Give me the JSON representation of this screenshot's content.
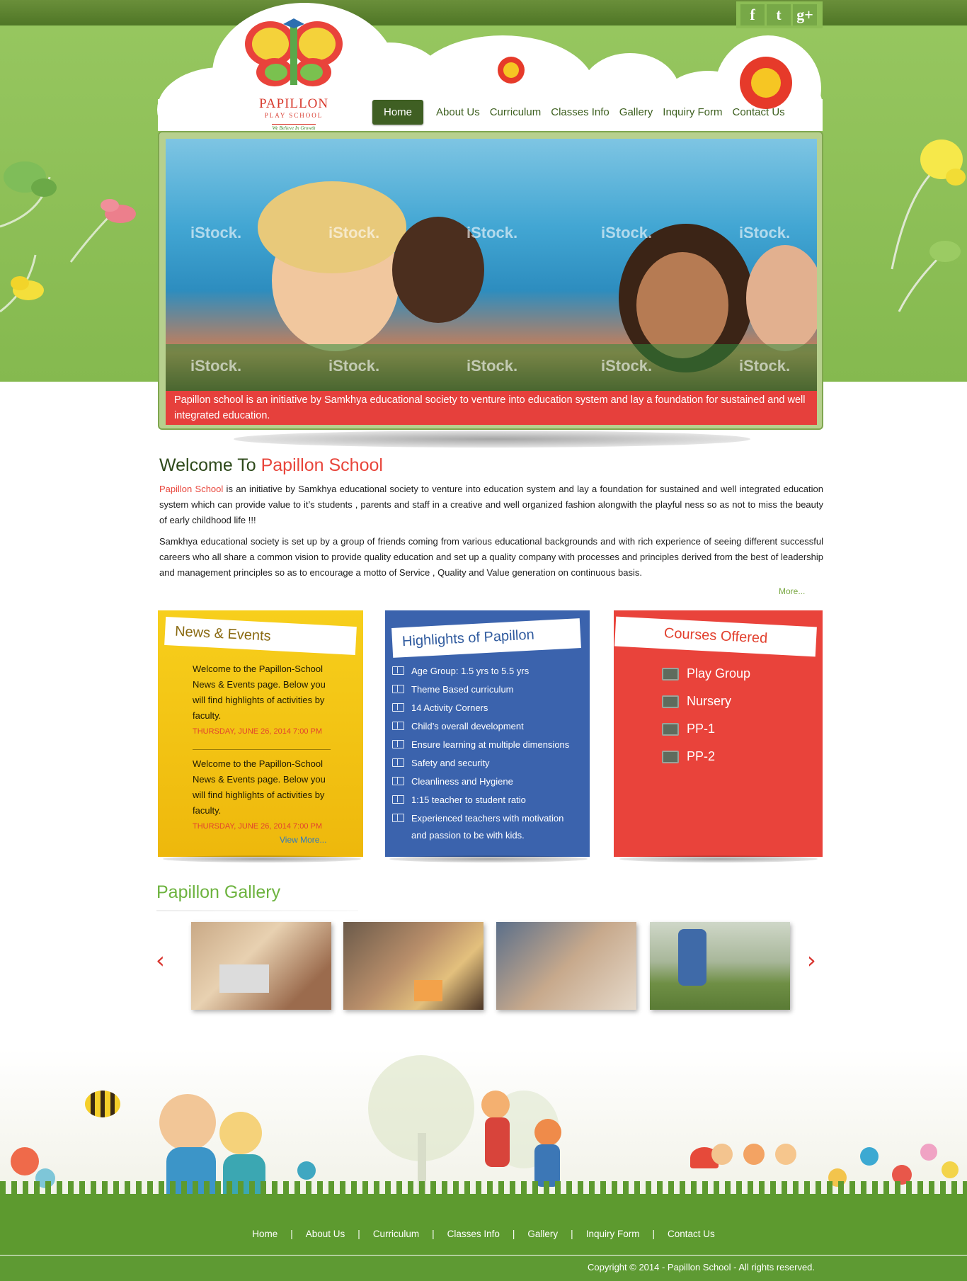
{
  "social": {
    "facebook": "f",
    "twitter": "t",
    "googleplus": "g+"
  },
  "logo": {
    "title": "PAPILLON",
    "subtitle": "PLAY SCHOOL",
    "tagline": "We Believe In Growth"
  },
  "nav": {
    "items": [
      "Home",
      "About Us",
      "Curriculum",
      "Classes Info",
      "Gallery",
      "Inquiry Form",
      "Contact Us"
    ],
    "active": "Home"
  },
  "slider": {
    "watermark": "iStock.",
    "caption": "Papillon school  is an initiative by Samkhya educational society  to venture into education system and lay a foundation for sustained and well integrated education."
  },
  "welcome": {
    "title_prefix": "Welcome To ",
    "title_name": "Papillon  School",
    "p1_name": "Papillon School",
    "p1": "  is an initiative by Samkhya educational society  to venture into education system and lay a foundation for sustained and well integrated education system which can provide value to it’s students , parents and staff in a creative and well organized fashion alongwith the playful ness so as not to miss the beauty of early childhood life !!!",
    "p2": "Samkhya educational society is set up by a group of friends coming from various educational backgrounds and with rich experience of  seeing different successful careers who all share a common vision to provide quality education and set up a quality company with processes and principles derived from the best of leadership and management principles so as to encourage a motto of Service , Quality and Value generation on continuous basis.",
    "more": "More..."
  },
  "news": {
    "title": "News & Events",
    "items": [
      {
        "text": "Welcome to the Papillon-School News & Events page.  Below you will find highlights of activities by faculty.",
        "date": "THURSDAY, JUNE 26, 2014 7:00 PM"
      },
      {
        "text": "Welcome to the Papillon-School News & Events page.  Below you will find highlights of activities by faculty.",
        "date": "THURSDAY, JUNE 26, 2014 7:00 PM"
      }
    ],
    "view_more": "View More..."
  },
  "highlights": {
    "title": "Highlights of Papillon",
    "items": [
      "Age Group: 1.5 yrs to 5.5 yrs",
      "Theme Based curriculum",
      "14 Activity Corners",
      "Child’s overall development",
      "Ensure learning at multiple dimensions",
      "Safety and security",
      "Cleanliness and Hygiene",
      "1:15 teacher to student ratio",
      "Experienced teachers with motivation"
    ],
    "continuation": "and passion to be with kids."
  },
  "courses": {
    "title": "Courses Offered",
    "items": [
      "Play Group",
      "Nursery",
      "PP-1",
      "PP-2"
    ]
  },
  "gallery": {
    "title": "Papillon Gallery",
    "prev": "‹",
    "next": "›"
  },
  "footer": {
    "nav": [
      "Home",
      "About Us",
      "Curriculum",
      "Classes Info",
      "Gallery",
      "Inquiry Form",
      "Contact Us"
    ],
    "separator": "|",
    "copyright": "Copyright © 2014 - Papillon School - All rights reserved."
  },
  "colors": {
    "green": "#8cbd55",
    "dark_green": "#3f5f23",
    "red": "#e9433b",
    "yellow": "#f4c619",
    "blue": "#3b63ad"
  }
}
